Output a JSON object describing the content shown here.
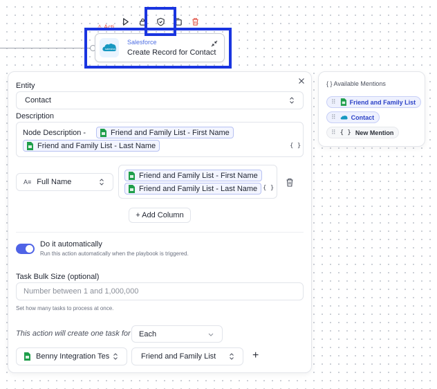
{
  "toolbar": {
    "buttons": [
      "play-icon",
      "lock-icon",
      "shield-icon",
      "duplicate-icon",
      "trash-icon"
    ],
    "delete_color": "#e2564a"
  },
  "highlight_color": "#1a35e0",
  "node": {
    "tag": "Acti",
    "app": "Salesforce",
    "title": "Create Record for Contact"
  },
  "form": {
    "entity_label": "Entity",
    "entity_value": "Contact",
    "description_label": "Description",
    "description_prefix": "Node Description -",
    "description_chips": [
      "Friend and Family List - First Name",
      "Friend and Family List - Last Name"
    ],
    "braces": "{ }",
    "column": {
      "field": "Full Name",
      "chips": [
        "Friend and Family List - First Name",
        "Friend and Family List - Last Name"
      ]
    },
    "add_column_label": "+ Add Column",
    "auto": {
      "title": "Do it automatically",
      "subtitle": "Run this action automatically when the playbook is triggered.",
      "enabled": true
    },
    "bulk": {
      "label": "Task Bulk Size (optional)",
      "placeholder": "Number between 1 and 1,000,000",
      "help": "Set how many tasks to process at once."
    },
    "task_for": {
      "text": "This action will create one task for",
      "value": "Each"
    },
    "source_integration": "Benny Integration Tes",
    "source_list": "Friend and Family List",
    "add_label": "+"
  },
  "mentions": {
    "title": "{ } Available Mentions",
    "items": [
      {
        "label": "Friend and Family List",
        "icon": "sheet-icon"
      },
      {
        "label": "Contact",
        "icon": "salesforce-icon"
      },
      {
        "label": "New Mention",
        "icon": "braces-icon"
      }
    ]
  },
  "accent_color": "#4f63e6",
  "sheet_color": "#1e9e4a"
}
